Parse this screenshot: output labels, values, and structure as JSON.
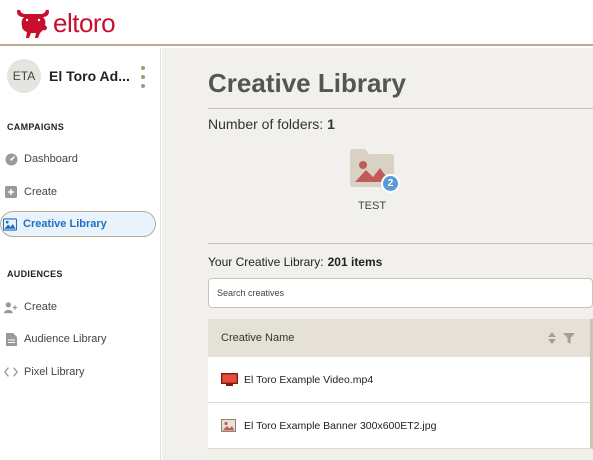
{
  "brand": {
    "name": "eltoro",
    "accent": "#c8102e"
  },
  "account": {
    "initials": "ETA",
    "name": "El Toro Ad..."
  },
  "sidebar": {
    "campaigns_title": "CAMPAIGNS",
    "campaign_items": [
      {
        "label": "Dashboard",
        "icon": "dashboard-icon"
      },
      {
        "label": "Create",
        "icon": "plus-square-icon"
      },
      {
        "label": "Creative Library",
        "icon": "creative-library-icon",
        "active": true
      }
    ],
    "audiences_title": "AUDIENCES",
    "audience_items": [
      {
        "label": "Create",
        "icon": "add-user-icon"
      },
      {
        "label": "Audience Library",
        "icon": "document-icon"
      },
      {
        "label": "Pixel Library",
        "icon": "code-icon"
      }
    ]
  },
  "main": {
    "title": "Creative Library",
    "folders_label": "Number of folders:",
    "folders_count": "1",
    "folder": {
      "name": "TEST",
      "badge": "2"
    },
    "library_label": "Your Creative Library:",
    "library_count": "201 items",
    "search_placeholder": "Search creatives",
    "table": {
      "column": "Creative Name",
      "rows": [
        {
          "name": "El Toro Example Video.mp4",
          "icon": "video-icon"
        },
        {
          "name": "El Toro Example Banner 300x600ET2.jpg",
          "icon": "image-icon"
        }
      ]
    }
  },
  "colors": {
    "sidebar_active": "#1f6fc5",
    "badge": "#5b9bd5",
    "main_bg": "#f1f0ed"
  }
}
